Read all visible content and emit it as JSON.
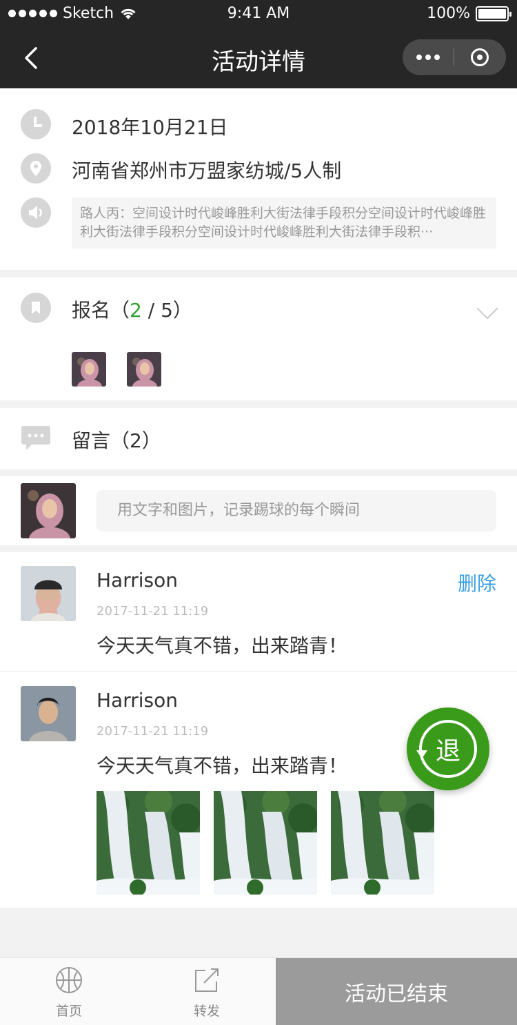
{
  "status_bar": {
    "carrier": "Sketch",
    "time": "9:41 AM",
    "battery": "100%"
  },
  "nav": {
    "title": "活动详情"
  },
  "info": {
    "date": "2018年10月21日",
    "location": "河南省郑州市万盟家纺城/5人制",
    "description": "路人丙：空间设计时代峻峰胜利大街法律手段积分空间设计时代峻峰胜利大街法律手段积分空间设计时代峻峰胜利大街法律手段积···"
  },
  "signup": {
    "label": "报名（",
    "count": "2",
    "sep": " / ",
    "total": "5",
    "close": "）",
    "count_color": "#2ba12b"
  },
  "messages": {
    "label": "留言（2）"
  },
  "comment_input": {
    "placeholder": "用文字和图片，记录踢球的每个瞬间"
  },
  "comments": [
    {
      "name": "Harrison",
      "time": "2017-11-21   11:19",
      "text": "今天天气真不错，出来踏青！",
      "delete_label": "删除"
    },
    {
      "name": "Harrison",
      "time": "2017-11-21   11:19",
      "text": "今天天气真不错，出来踏青！"
    }
  ],
  "fab": {
    "label": "退",
    "color": "#3a9b1b"
  },
  "tabbar": {
    "home": "首页",
    "share": "转发",
    "end": "活动已结束"
  }
}
